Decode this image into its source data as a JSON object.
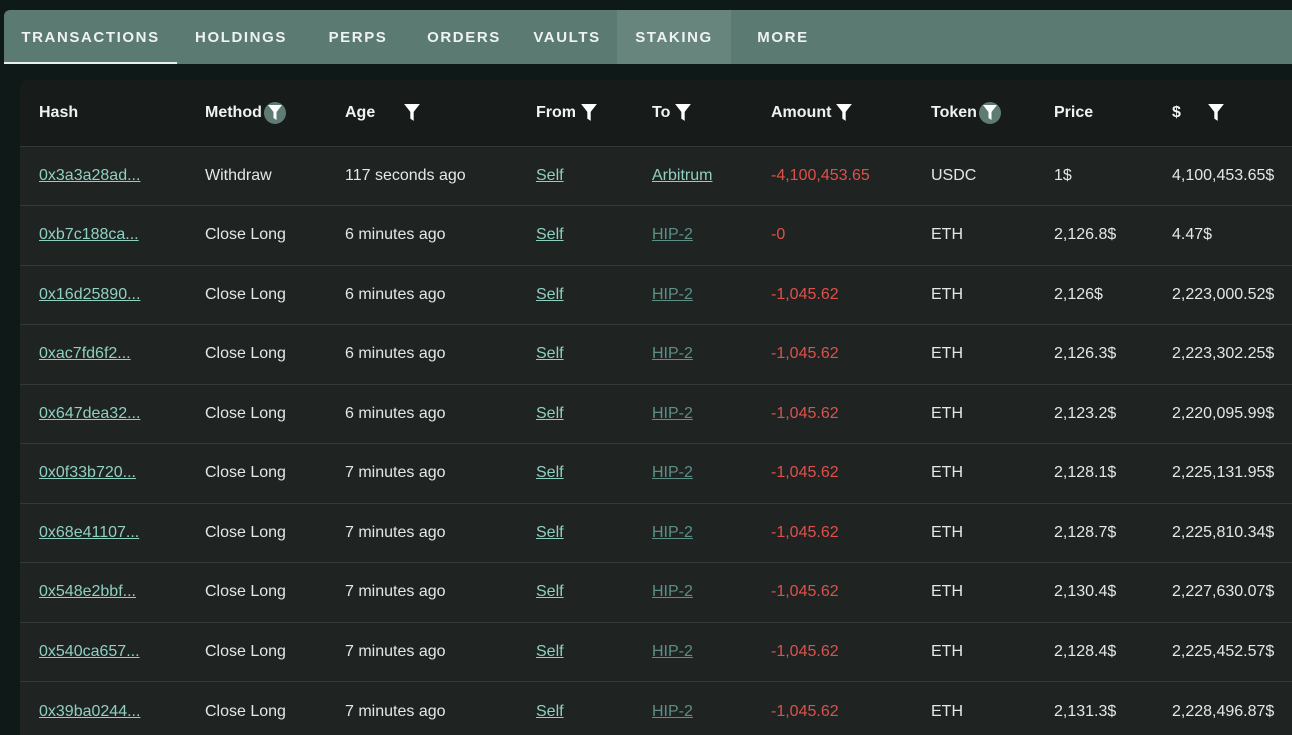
{
  "tabs": [
    {
      "label": "TRANSACTIONS",
      "active": true
    },
    {
      "label": "HOLDINGS"
    },
    {
      "label": "PERPS"
    },
    {
      "label": "ORDERS"
    },
    {
      "label": "VAULTS"
    },
    {
      "label": "STAKING",
      "hover": true
    },
    {
      "label": "MORE"
    }
  ],
  "table": {
    "headers": [
      "Hash",
      "Method",
      "Age",
      "From",
      "To",
      "Amount",
      "Token",
      "Price",
      "$"
    ],
    "rows": [
      {
        "hash": "0x3a3a28ad...",
        "method": "Withdraw",
        "age": "117 seconds ago",
        "from": "Self",
        "to": "Arbitrum",
        "amount": "-4,100,453.65",
        "token": "USDC",
        "price": "1$",
        "usd": "4,100,453.65$"
      },
      {
        "hash": "0xb7c188ca...",
        "method": "Close Long",
        "age": "6 minutes ago",
        "from": "Self",
        "to": "HIP-2",
        "amount": "-0",
        "token": "ETH",
        "price": "2,126.8$",
        "usd": "4.47$"
      },
      {
        "hash": "0x16d25890...",
        "method": "Close Long",
        "age": "6 minutes ago",
        "from": "Self",
        "to": "HIP-2",
        "amount": "-1,045.62",
        "token": "ETH",
        "price": "2,126$",
        "usd": "2,223,000.52$"
      },
      {
        "hash": "0xac7fd6f2...",
        "method": "Close Long",
        "age": "6 minutes ago",
        "from": "Self",
        "to": "HIP-2",
        "amount": "-1,045.62",
        "token": "ETH",
        "price": "2,126.3$",
        "usd": "2,223,302.25$"
      },
      {
        "hash": "0x647dea32...",
        "method": "Close Long",
        "age": "6 minutes ago",
        "from": "Self",
        "to": "HIP-2",
        "amount": "-1,045.62",
        "token": "ETH",
        "price": "2,123.2$",
        "usd": "2,220,095.99$"
      },
      {
        "hash": "0x0f33b720...",
        "method": "Close Long",
        "age": "7 minutes ago",
        "from": "Self",
        "to": "HIP-2",
        "amount": "-1,045.62",
        "token": "ETH",
        "price": "2,128.1$",
        "usd": "2,225,131.95$"
      },
      {
        "hash": "0x68e41107...",
        "method": "Close Long",
        "age": "7 minutes ago",
        "from": "Self",
        "to": "HIP-2",
        "amount": "-1,045.62",
        "token": "ETH",
        "price": "2,128.7$",
        "usd": "2,225,810.34$"
      },
      {
        "hash": "0x548e2bbf...",
        "method": "Close Long",
        "age": "7 minutes ago",
        "from": "Self",
        "to": "HIP-2",
        "amount": "-1,045.62",
        "token": "ETH",
        "price": "2,130.4$",
        "usd": "2,227,630.07$"
      },
      {
        "hash": "0x540ca657...",
        "method": "Close Long",
        "age": "7 minutes ago",
        "from": "Self",
        "to": "HIP-2",
        "amount": "-1,045.62",
        "token": "ETH",
        "price": "2,128.4$",
        "usd": "2,225,452.57$"
      },
      {
        "hash": "0x39ba0244...",
        "method": "Close Long",
        "age": "7 minutes ago",
        "from": "Self",
        "to": "HIP-2",
        "amount": "-1,045.62",
        "token": "ETH",
        "price": "2,131.3$",
        "usd": "2,228,496.87$"
      }
    ]
  },
  "colors": {
    "accent_link": "#8fd0c0",
    "dim_link": "#5c8f86",
    "negative": "#e0504a",
    "tab_bar": "#5b7a72"
  }
}
